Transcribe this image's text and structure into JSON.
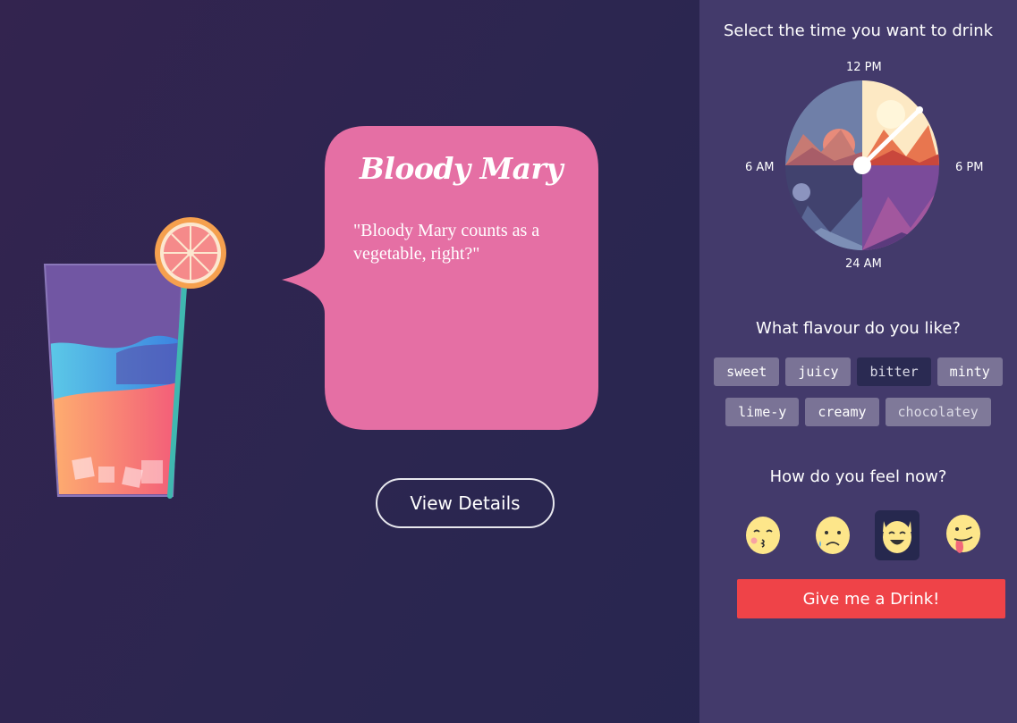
{
  "drink": {
    "name": "Bloody Mary",
    "quote": "\"Bloody Mary counts as a vegetable, right?\""
  },
  "details_button": "View Details",
  "time_section": {
    "title": "Select the time you want to drink",
    "labels": {
      "top": "12 PM",
      "left": "6 AM",
      "right": "6 PM",
      "bottom": "24 AM"
    }
  },
  "flavour_section": {
    "title": "What flavour do you like?",
    "row1": [
      "sweet",
      "juicy",
      "bitter",
      "minty"
    ],
    "row2": [
      "lime-y",
      "creamy",
      "chocolatey"
    ],
    "selected": "bitter"
  },
  "feel_section": {
    "title": "How do you feel now?",
    "emojis": [
      "kissing-face-icon",
      "sad-tear-face-icon",
      "rock-on-face-icon",
      "tongue-out-face-icon"
    ],
    "selected": "rock-on-face-icon"
  },
  "submit_button": "Give me a Drink!",
  "colors": {
    "panel": "#433a6b",
    "bubble": "#e56fa4",
    "accent": "#ef4348"
  }
}
